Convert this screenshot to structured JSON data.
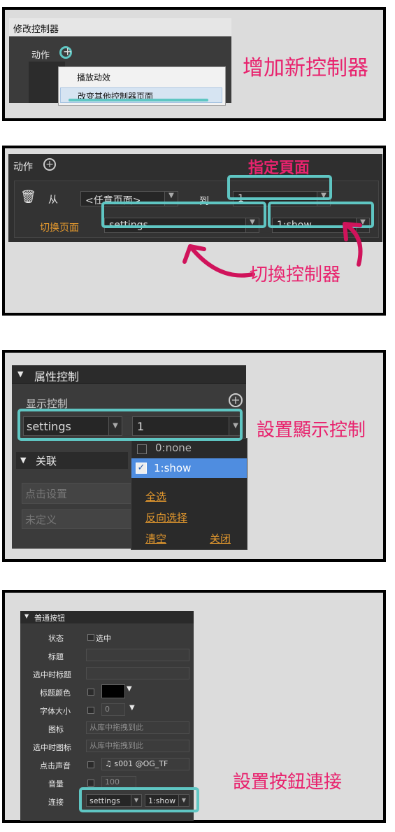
{
  "panel1": {
    "title": "修改控制器",
    "actions_label": "动作",
    "menu_items": [
      "播放动效",
      "改变其他控制器页面"
    ],
    "caption": "增加新控制器"
  },
  "panel2": {
    "actions_label": "动作",
    "from_label": "从",
    "from_value": "<任意页面>",
    "to_label": "到",
    "to_value": "1",
    "switch_label": "切换页面",
    "controller_value": "settings",
    "page_value": "1:show",
    "caption_top": "指定頁面",
    "caption_bottom": "切換控制器"
  },
  "panel3": {
    "section_title": "属性控制",
    "display_label": "显示控制",
    "controller_value": "settings",
    "page_value": "1",
    "linkage_title": "关联",
    "click_setting": "点击设置",
    "undefined": "未定义",
    "options": [
      {
        "label": "0:none",
        "checked": false
      },
      {
        "label": "1:show",
        "checked": true
      }
    ],
    "select_all": "全选",
    "invert": "反向选择",
    "clear": "清空",
    "close": "关闭",
    "caption": "設置顯示控制"
  },
  "panel4": {
    "section_title": "普通按钮",
    "rows": {
      "state_label": "状态",
      "state_check": "选中",
      "title_label": "标题",
      "selected_title_label": "选中时标题",
      "title_color_label": "标题颜色",
      "font_size_label": "字体大小",
      "font_size_value": "0",
      "icon_label": "图标",
      "icon_placeholder": "从库中拖拽到此",
      "selected_icon_label": "选中时图标",
      "selected_icon_placeholder": "从库中拖拽到此",
      "sound_label": "点击声音",
      "sound_value": "s001 @OG_TF",
      "volume_label": "音量",
      "volume_value": "100",
      "link_label": "连接",
      "link_controller": "settings",
      "link_page": "1:show"
    },
    "caption": "設置按鈕連接"
  },
  "colors": {
    "highlight_teal": "#5fc6c3",
    "caption_pink": "#e8236e",
    "label_orange": "#e69a2e",
    "selected_blue": "#4f8de0"
  }
}
